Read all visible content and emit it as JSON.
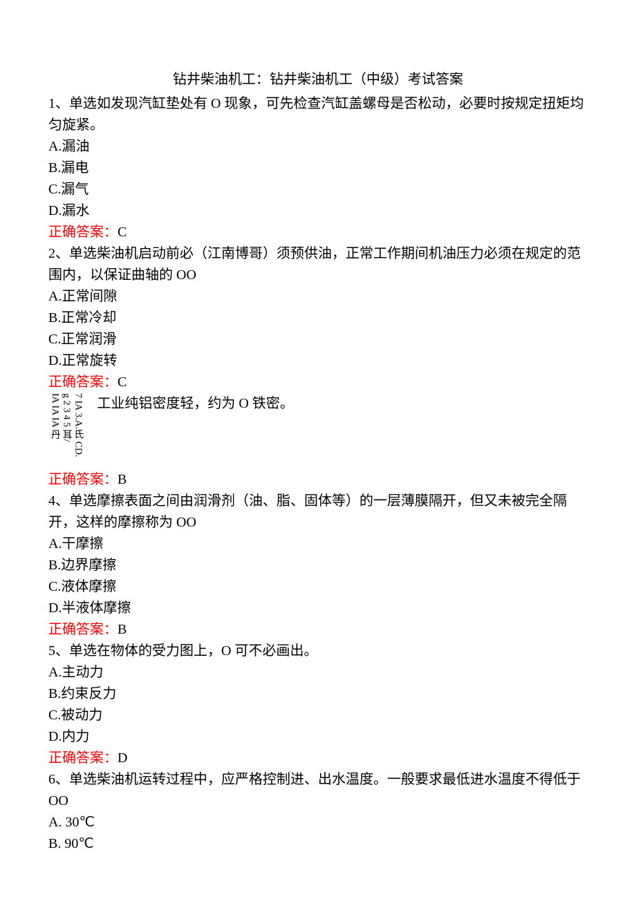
{
  "title": "钻井柴油机工：钻井柴油机工（中级）考试答案",
  "answer_label": "正确答案：",
  "questions": {
    "q1": {
      "text": "1、单选如发现汽缸垫处有 O 现象，可先检查汽缸盖螺母是否松动，必要时按规定扭矩均匀旋紧。",
      "opts": {
        "a": "A.漏油",
        "b": "B.漏电",
        "c": "C.漏气",
        "d": "D.漏水"
      },
      "answer": "C"
    },
    "q2": {
      "text": "2、单选柴油机启动前必（江南博哥）须预供油，正常工作期间机油压力必须在规定的范围内，以保证曲轴的 OO",
      "opts": {
        "a": "A.正常间隙",
        "b": "B.正常冷却",
        "c": "C.正常润滑",
        "d": "D.正常旋转"
      },
      "answer": "C"
    },
    "q3": {
      "vertical1": "7 IA 3.A.氏 CD.",
      "vertical2": "g 2 3 4 5 耳/",
      "vertical3": "IA IA IA 丹",
      "text": "工业纯铝密度轻，约为 O 铁密。",
      "answer": "B"
    },
    "q4": {
      "text": "4、单选摩擦表面之间由润滑剂（油、脂、固体等）的一层薄膜隔开，但又未被完全隔开，这样的摩擦称为 OO",
      "opts": {
        "a": "A.干摩擦",
        "b": "B.边界摩擦",
        "c": "C.液体摩擦",
        "d": "D.半液体摩擦"
      },
      "answer": "B"
    },
    "q5": {
      "text": "5、单选在物体的受力图上，O 可不必画出。",
      "opts": {
        "a": "A.主动力",
        "b": "B.约束反力",
        "c": "C.被动力",
        "d": "D.内力"
      },
      "answer": "D"
    },
    "q6": {
      "text": "6、单选柴油机运转过程中，应严格控制进、出水温度。一般要求最低进水温度不得低于 OO",
      "opts": {
        "a": "A. 30℃",
        "b": "B. 90℃"
      }
    }
  }
}
